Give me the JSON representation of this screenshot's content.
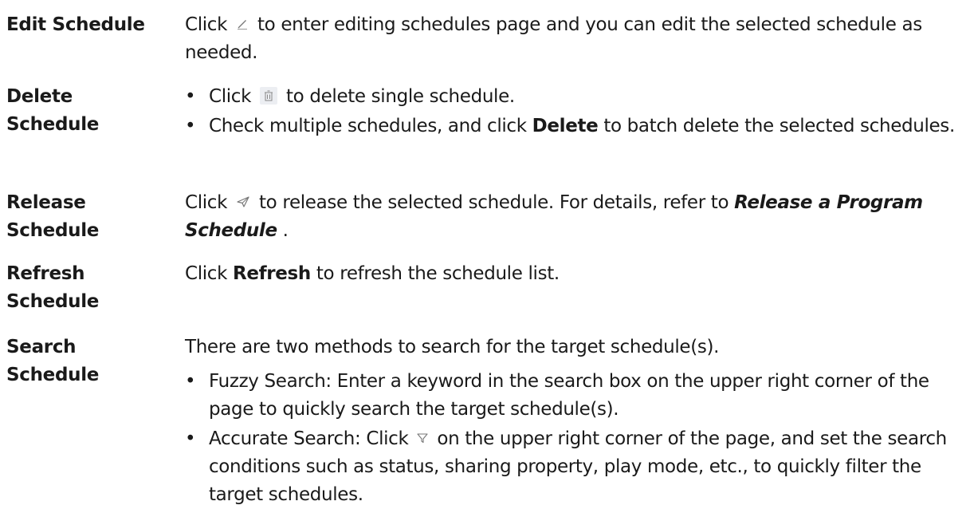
{
  "rows": {
    "edit": {
      "term": "Edit Schedule",
      "pre": "Click",
      "icon": "pencil-icon",
      "post": "to enter editing schedules page and you can edit the selected schedule as needed."
    },
    "delete": {
      "term_line1": "Delete",
      "term_line2": "Schedule",
      "b1_pre": "Click",
      "b1_icon": "trash-icon",
      "b1_post": "to delete single schedule.",
      "b2_pre": "Check multiple schedules, and click",
      "b2_bold": "Delete",
      "b2_post": "to batch delete the selected schedules."
    },
    "release": {
      "term_line1": "Release",
      "term_line2": "Schedule",
      "pre": "Click",
      "icon": "send-icon",
      "post": "to release the selected schedule. For details, refer to",
      "ref": "Release a Program Schedule",
      "end": "."
    },
    "refresh": {
      "term_line1": "Refresh",
      "term_line2": "Schedule",
      "pre": "Click",
      "bold": "Refresh",
      "post": "to refresh the schedule list."
    },
    "search": {
      "term_line1": "Search",
      "term_line2": "Schedule",
      "intro": "There are two methods to search for the target schedule(s).",
      "b1": "Fuzzy Search: Enter a keyword in the search box on the upper right corner of the page to quickly search the target schedule(s).",
      "b2_pre": "Accurate Search: Click",
      "b2_icon": "filter-icon",
      "b2_post": "on the upper right corner of the page, and set the search conditions such as status, sharing property, play mode, etc., to quickly filter the target schedules."
    }
  }
}
